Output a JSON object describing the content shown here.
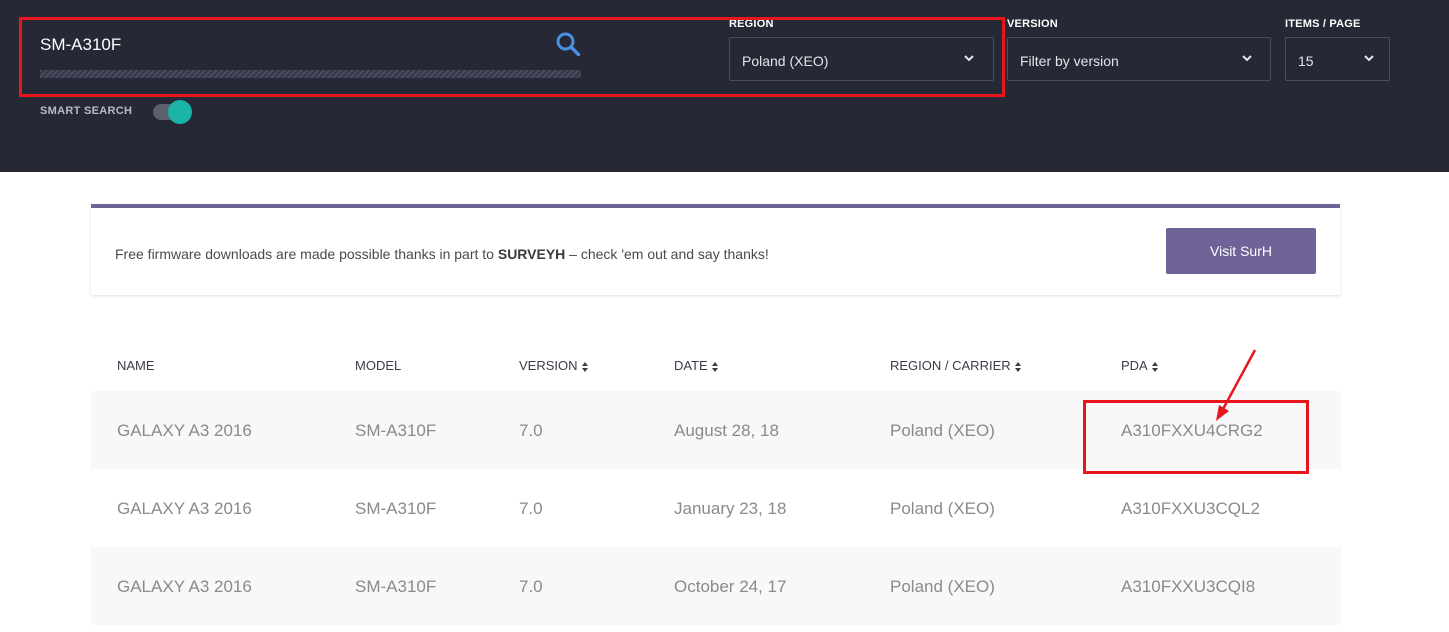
{
  "search": {
    "value": "SM-A310F",
    "smart_search_label": "SMART SEARCH",
    "smart_search_on": true
  },
  "filters": {
    "region": {
      "label": "REGION",
      "selected": "Poland (XEO)"
    },
    "version": {
      "label": "VERSION",
      "selected": "Filter by version"
    },
    "items_per_page": {
      "label": "ITEMS / PAGE",
      "selected": "15"
    }
  },
  "sponsor": {
    "text_before": "Free firmware downloads are made possible thanks in part to ",
    "sponsor_name": "SURVEYH",
    "text_after": " – check 'em out and say thanks!",
    "button_label": "Visit SurH"
  },
  "table": {
    "columns": [
      {
        "label": "NAME",
        "sortable": false
      },
      {
        "label": "MODEL",
        "sortable": false
      },
      {
        "label": "VERSION",
        "sortable": true
      },
      {
        "label": "DATE",
        "sortable": true
      },
      {
        "label": "REGION / CARRIER",
        "sortable": true
      },
      {
        "label": "PDA",
        "sortable": true
      }
    ],
    "rows": [
      [
        "GALAXY A3 2016",
        "SM-A310F",
        "7.0",
        "August 28, 18",
        "Poland (XEO)",
        "A310FXXU4CRG2"
      ],
      [
        "GALAXY A3 2016",
        "SM-A310F",
        "7.0",
        "January 23, 18",
        "Poland (XEO)",
        "A310FXXU3CQL2"
      ],
      [
        "GALAXY A3 2016",
        "SM-A310F",
        "7.0",
        "October 24, 17",
        "Poland (XEO)",
        "A310FXXU3CQI8"
      ]
    ]
  },
  "colors": {
    "header_bg": "#262836",
    "accent_teal": "#1ab3a5",
    "accent_purple": "#6e6296",
    "search_icon": "#4a90e2",
    "annotation_red": "#e8161c"
  },
  "icons": {
    "search": "search-icon",
    "dropdown": "chevron-down-icon",
    "sort": "sort-icon"
  }
}
